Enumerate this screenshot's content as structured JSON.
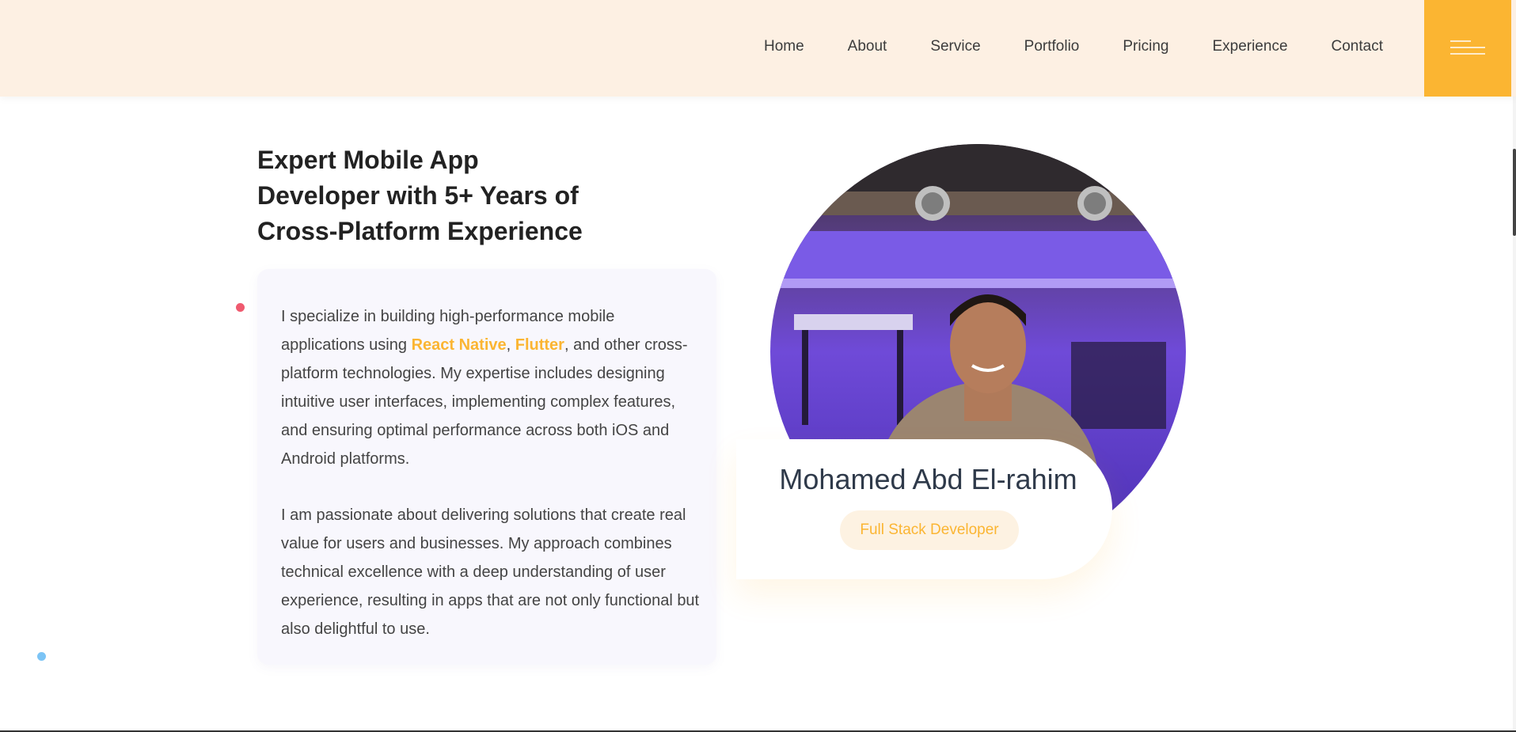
{
  "nav": {
    "links": [
      "Home",
      "About",
      "Service",
      "Portfolio",
      "Pricing",
      "Experience",
      "Contact"
    ],
    "menu_icon": "hamburger-menu-icon"
  },
  "hero": {
    "headline": "Expert Mobile App Developer with 5+ Years of Cross-Platform Experience",
    "paragraph1": {
      "before": "I specialize in building high-performance mobile applications using ",
      "highlight1": "React Native",
      "sep": ", ",
      "highlight2": "Flutter",
      "after": ", and other cross-platform technologies. My expertise includes designing intuitive user interfaces, implementing complex features, and ensuring optimal performance across both iOS and Android platforms."
    },
    "paragraph2": "I am passionate about delivering solutions that create real value for users and businesses. My approach combines technical excellence with a deep understanding of user experience, resulting in apps that are not only functional but also delightful to use."
  },
  "profile": {
    "name": "Mohamed Abd El-rahim",
    "role": "Full Stack Developer"
  },
  "colors": {
    "accent": "#fbb532",
    "nav_bg": "#fdf0e3",
    "card_bg": "#f8f7fd",
    "dot_red": "#ef5a6f",
    "dot_blue": "#7cc4f5"
  }
}
